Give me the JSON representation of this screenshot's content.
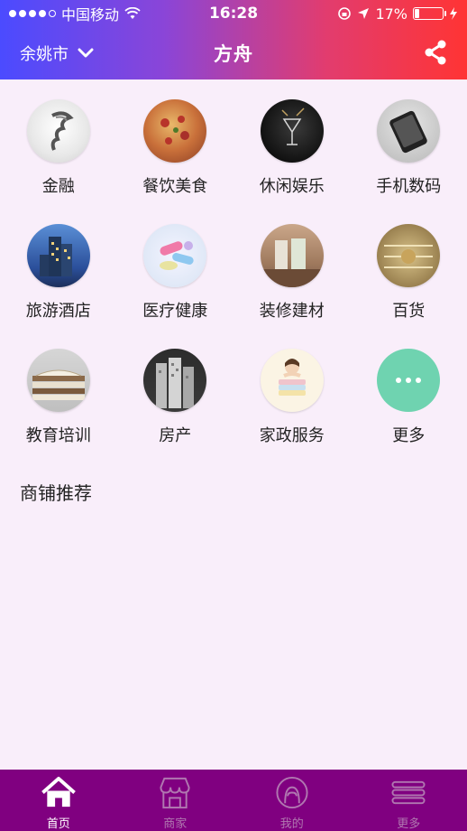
{
  "status": {
    "carrier": "中国移动",
    "time": "16:28",
    "battery": "17%",
    "battery_level": 0.17
  },
  "nav": {
    "city": "余姚市",
    "title": "方舟"
  },
  "categories": [
    {
      "label": "金融",
      "icon": "finance-icon"
    },
    {
      "label": "餐饮美食",
      "icon": "food-icon"
    },
    {
      "label": "休闲娱乐",
      "icon": "leisure-icon"
    },
    {
      "label": "手机数码",
      "icon": "digital-icon"
    },
    {
      "label": "旅游酒店",
      "icon": "hotel-icon"
    },
    {
      "label": "医疗健康",
      "icon": "medical-icon"
    },
    {
      "label": "装修建材",
      "icon": "decoration-icon"
    },
    {
      "label": "百货",
      "icon": "department-store-icon"
    },
    {
      "label": "教育培训",
      "icon": "education-icon"
    },
    {
      "label": "房产",
      "icon": "real-estate-icon"
    },
    {
      "label": "家政服务",
      "icon": "housekeeping-icon"
    },
    {
      "label": "更多",
      "icon": "more-icon"
    }
  ],
  "section": {
    "title": "商铺推荐"
  },
  "tabs": [
    {
      "label": "首页",
      "icon": "home-icon"
    },
    {
      "label": "商家",
      "icon": "shop-icon"
    },
    {
      "label": "我的",
      "icon": "profile-icon"
    },
    {
      "label": "更多",
      "icon": "menu-icon"
    }
  ],
  "colors": {
    "header_gradient": [
      "#4b4bff",
      "#ff3434"
    ],
    "tabbar": "#800080",
    "background": "#f9eefa",
    "more_circle": "#6fd3b0"
  }
}
